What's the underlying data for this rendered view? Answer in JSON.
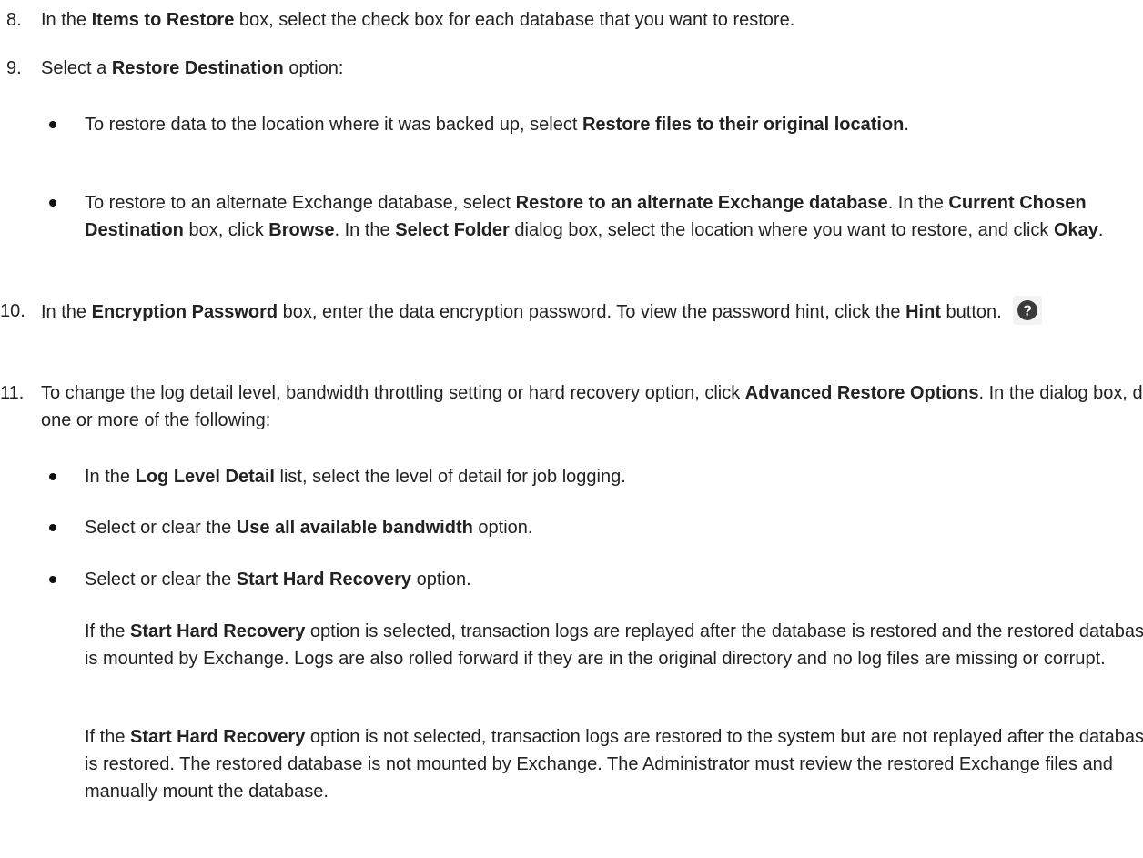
{
  "steps": [
    {
      "number": "8.",
      "t0": "In the ",
      "b0": "Items to Restore",
      "t1": " box, select the check box for each database that you want to restore."
    },
    {
      "number": "9.",
      "t0": "Select a ",
      "b0": "Restore Destination",
      "t1": " option:",
      "bullets": [
        {
          "t0": "To restore data to the location where it was backed up, select ",
          "b0": "Restore files to their original location",
          "t1": "."
        },
        {
          "t0": "To restore to an alternate Exchange database, select ",
          "b0": "Restore to an alternate Exchange database",
          "t1": ". In the ",
          "b1": "Current Chosen Destination",
          "t2": " box, click ",
          "b2": "Browse",
          "t3": ". In the ",
          "b3": "Select Folder",
          "t4": " dialog box, select the location where you want to restore, and click ",
          "b4": "Okay",
          "t5": "."
        }
      ]
    },
    {
      "number": "10.",
      "t0": "In the ",
      "b0": "Encryption Password",
      "t1": " box, enter the data encryption password. To view the password hint, click the ",
      "b1": "Hint",
      "t2": " button.",
      "icon": "question-circle-icon"
    },
    {
      "number": "11.",
      "t0": "To change the log detail level, bandwidth throttling setting or hard recovery option, click ",
      "b0": "Advanced Restore Options",
      "t1": ". In the dialog box, do one or more of the following:",
      "bullets": [
        {
          "t0": "In the ",
          "b0": "Log Level Detail",
          "t1": " list, select the level of detail for job logging."
        },
        {
          "t0": "Select or clear the ",
          "b0": "Use all available bandwidth",
          "t1": " option."
        },
        {
          "t0": "Select or clear the ",
          "b0": "Start Hard Recovery",
          "t1": " option."
        }
      ],
      "paragraphs": [
        {
          "t0": "If the ",
          "b0": "Start Hard Recovery",
          "t1": " option is selected, transaction logs are replayed after the database is restored and the restored database is mounted by Exchange. Logs are also rolled forward if they are in the original directory and no log files are missing or corrupt."
        },
        {
          "t0": "If the ",
          "b0": "Start Hard Recovery",
          "t1": " option is not selected, transaction logs are restored to the system but are not replayed after the database is restored. The restored database is not mounted by Exchange. The Administrator must review the restored Exchange files and manually mount the database."
        }
      ]
    }
  ]
}
